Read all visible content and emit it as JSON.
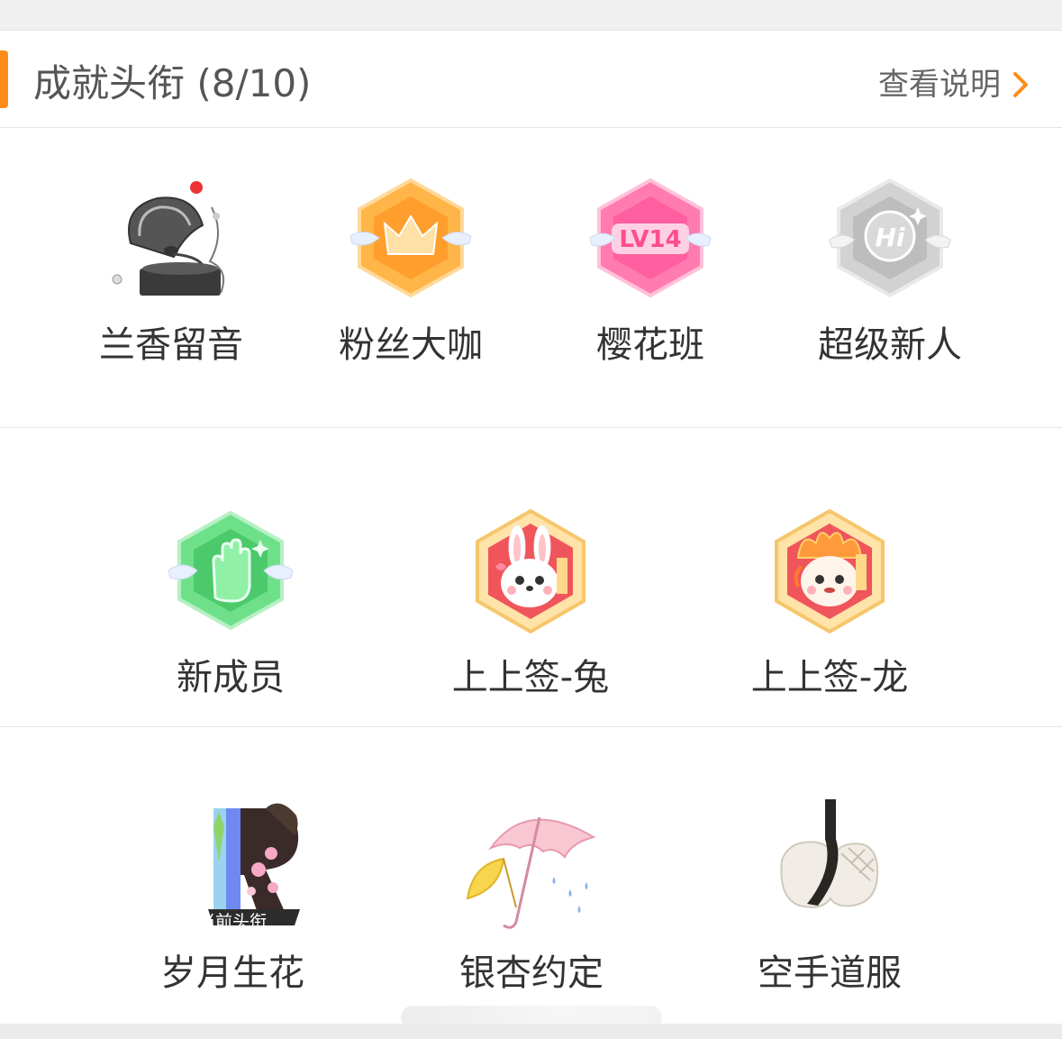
{
  "header": {
    "title": "成就头衔 (8/10)",
    "help_label": "查看说明"
  },
  "colors": {
    "accent": "#ff8c1a",
    "card_bg": "#ffffff",
    "page_bg": "#f0f0f0"
  },
  "badges": [
    {
      "name": "兰香留音",
      "icon": "gramophone-icon",
      "has_red_dot": true
    },
    {
      "name": "粉丝大咖",
      "icon": "crown-hexagon-icon"
    },
    {
      "name": "樱花班",
      "icon": "lv14-hexagon-icon",
      "icon_text": "LV14"
    },
    {
      "name": "超级新人",
      "icon": "hi-hexagon-icon",
      "icon_text": "Hi"
    },
    {
      "name": "新成员",
      "icon": "hand-hexagon-icon"
    },
    {
      "name": "上上签-兔",
      "icon": "rabbit-hexagon-icon"
    },
    {
      "name": "上上签-龙",
      "icon": "dragon-hexagon-icon"
    },
    {
      "name": "岁月生花",
      "icon": "letter-r-icon",
      "tag": "当前头衔",
      "current": true
    },
    {
      "name": "银杏约定",
      "icon": "umbrella-ginkgo-icon"
    },
    {
      "name": "空手道服",
      "icon": "karate-uniform-icon"
    }
  ]
}
